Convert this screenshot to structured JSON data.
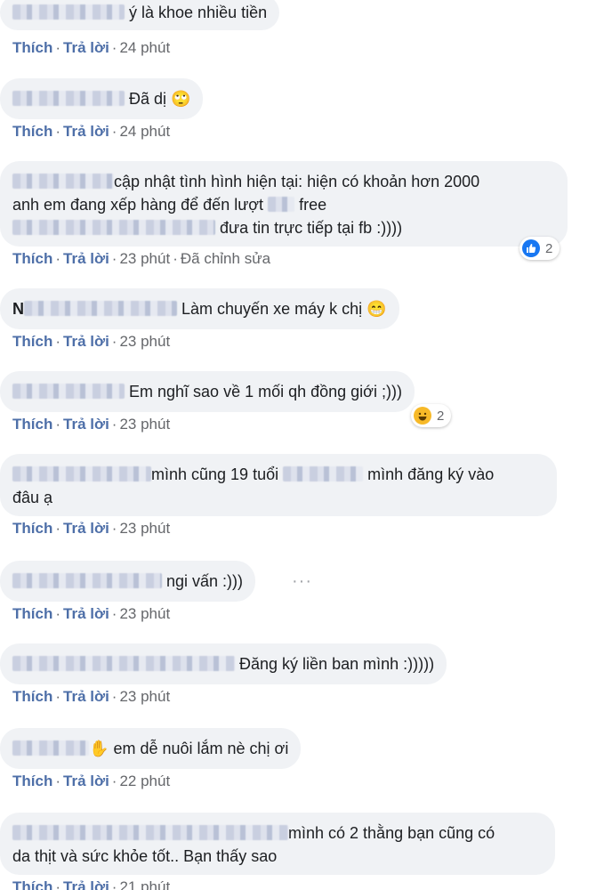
{
  "actions": {
    "like": "Thích",
    "reply": "Trả lời",
    "separator": "·",
    "edited": "Đã chỉnh sửa"
  },
  "comments": [
    {
      "text": "ý là khoe nhiều tiền",
      "time": "24 phút"
    },
    {
      "text": "Đã dị",
      "time": "24 phút",
      "emoji": "🙄"
    },
    {
      "line1": "cập nhật tình hình hiện tại: hiện có khoản hơn 2000",
      "line2a": "anh em đang xếp hàng để đến lượt",
      "line2b": "free",
      "line3": "đưa tin trực tiếp tại fb :))))",
      "time": "23 phút",
      "reaction_count": "2",
      "reaction_icon": "like-icon"
    },
    {
      "name_initial": "N",
      "text": "Làm chuyến xe máy k chị",
      "emoji": "😁",
      "time": "23 phút"
    },
    {
      "text": "Em nghĩ sao về 1 mối qh đồng giới ;)))",
      "time": "23 phút",
      "reaction_count": "2",
      "reaction_icon": "haha-icon"
    },
    {
      "line1a": "mình cũng 19 tuổi",
      "line1b": "mình đăng ký vào",
      "line2": "đâu ạ",
      "time": "23 phút"
    },
    {
      "text": "ngi vấn :)))",
      "time": "23 phút",
      "more": "···"
    },
    {
      "text": "Đăng ký liền ban mình :)))))",
      "time": "23 phút"
    },
    {
      "text": "em dễ nuôi lắm nè chị ơi",
      "emoji": "✋",
      "time": "22 phút"
    },
    {
      "line1": "mình có 2 thằng bạn cũng có",
      "line2": "da thịt và sức khỏe tốt.. Bạn thấy sao",
      "time": "21 phút"
    }
  ]
}
